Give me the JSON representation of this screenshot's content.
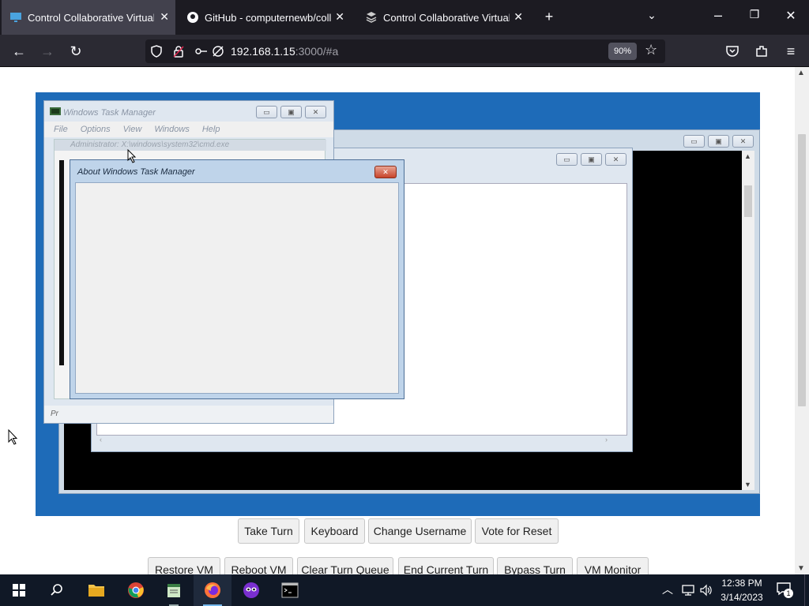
{
  "browser": {
    "tabs": [
      {
        "title": "Control Collaborative Virtual M",
        "active": true
      },
      {
        "title": "GitHub - computernewb/collab",
        "active": false
      },
      {
        "title": "Control Collaborative Virtual M",
        "active": false
      }
    ],
    "url_host": "192.168.1.15",
    "url_path": ":3000/#a",
    "zoom": "90%"
  },
  "vm": {
    "task_manager": {
      "title": "Windows Task Manager",
      "menu": [
        "File",
        "Options",
        "View",
        "Windows",
        "Help"
      ],
      "list_header": "Administrator: X:\\windows\\system32\\cmd.exe",
      "status": "Pr"
    },
    "about_dialog": {
      "title": "About Windows Task Manager"
    }
  },
  "controls": {
    "row1": [
      "Take Turn",
      "Keyboard",
      "Change Username",
      "Vote for Reset"
    ],
    "row2": [
      "Restore VM",
      "Reboot VM",
      "Clear Turn Queue",
      "End Current Turn",
      "Bypass Turn",
      "VM Monitor"
    ]
  },
  "taskbar": {
    "time": "12:38 PM",
    "date": "3/14/2023",
    "notification_count": "1"
  },
  "colors": {
    "vm_background": "#1e6bb8",
    "browser_dark": "#1c1b22",
    "taskbar": "#101826"
  }
}
